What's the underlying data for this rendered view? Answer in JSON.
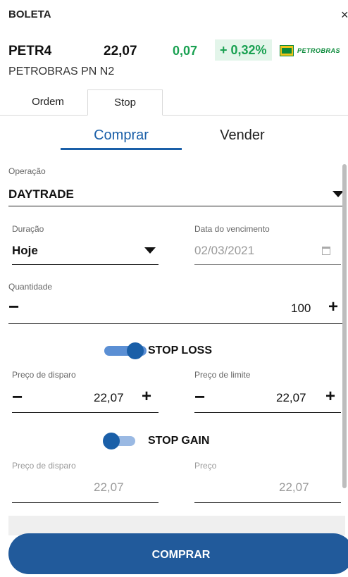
{
  "header": {
    "title": "BOLETA",
    "close_symbol": "×"
  },
  "quote": {
    "ticker": "PETR4",
    "price": "22,07",
    "change": "0,07",
    "change_pct": "+ 0,32%",
    "company": "PETROBRAS PN N2",
    "logo_text": "PETROBRAS",
    "change_color": "#1aa152"
  },
  "tabs": [
    {
      "label": "Ordem",
      "active": false
    },
    {
      "label": "Stop",
      "active": true
    }
  ],
  "side": {
    "buy_label": "Comprar",
    "sell_label": "Vender",
    "selected": "Comprar",
    "accent": "#1a5fa8"
  },
  "form": {
    "operacao": {
      "label": "Operação",
      "value": "DAYTRADE"
    },
    "duracao": {
      "label": "Duração",
      "value": "Hoje"
    },
    "vencimento": {
      "label": "Data do vencimento",
      "value": "02/03/2021"
    },
    "quantidade": {
      "label": "Quantidade",
      "value": "100",
      "minus": "−",
      "plus": "+"
    }
  },
  "stop_loss": {
    "label": "STOP LOSS",
    "enabled": true,
    "disparo": {
      "label": "Preço de disparo",
      "value": "22,07"
    },
    "limite": {
      "label": "Preço de limite",
      "value": "22,07"
    },
    "minus": "−",
    "plus": "+"
  },
  "stop_gain": {
    "label": "STOP GAIN",
    "enabled": false,
    "disparo": {
      "label": "Preço de disparo",
      "value": "22,07"
    },
    "preco": {
      "label": "Preço",
      "value": "22,07"
    }
  },
  "submit": {
    "label": "COMPRAR",
    "color": "#215a9b"
  }
}
